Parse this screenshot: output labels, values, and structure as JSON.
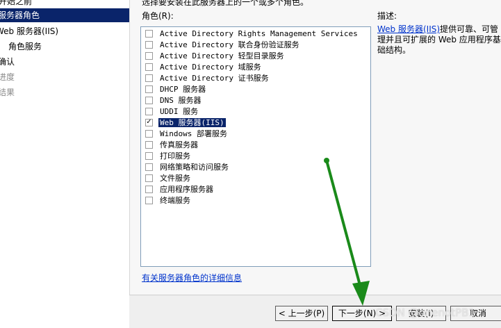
{
  "wizard": {
    "nav": [
      {
        "label": "开始之前",
        "state": "done"
      },
      {
        "label": "服务器角色",
        "state": "selected"
      },
      {
        "label": "Web 服务器(IIS)",
        "state": "normal"
      },
      {
        "label": "角色服务",
        "state": "normal"
      },
      {
        "label": "确认",
        "state": "normal"
      },
      {
        "label": "进度",
        "state": "disabled"
      },
      {
        "label": "结果",
        "state": "disabled"
      }
    ],
    "instruction": "选择要安装在此服务器上的一个或多个角色。",
    "roles_label": "角色(R):",
    "description_label": "描述:",
    "description": {
      "link_text": "Web 服务器(IIS)",
      "line1": "提供可靠、可管",
      "line2": "理并且可扩展的 Web 应用程序基",
      "line3": "础结构。"
    },
    "roles": [
      {
        "label": "Active Directory Rights Management Services",
        "checked": false,
        "selected": false
      },
      {
        "label": "Active Directory 联合身份验证服务",
        "checked": false,
        "selected": false
      },
      {
        "label": "Active Directory 轻型目录服务",
        "checked": false,
        "selected": false
      },
      {
        "label": "Active Directory 域服务",
        "checked": false,
        "selected": false
      },
      {
        "label": "Active Directory 证书服务",
        "checked": false,
        "selected": false
      },
      {
        "label": "DHCP 服务器",
        "checked": false,
        "selected": false
      },
      {
        "label": "DNS 服务器",
        "checked": false,
        "selected": false
      },
      {
        "label": "UDDI 服务",
        "checked": false,
        "selected": false
      },
      {
        "label": "Web 服务器(IIS)",
        "checked": true,
        "selected": true
      },
      {
        "label": "Windows 部署服务",
        "checked": false,
        "selected": false
      },
      {
        "label": "传真服务器",
        "checked": false,
        "selected": false
      },
      {
        "label": "打印服务",
        "checked": false,
        "selected": false
      },
      {
        "label": "网络策略和访问服务",
        "checked": false,
        "selected": false
      },
      {
        "label": "文件服务",
        "checked": false,
        "selected": false
      },
      {
        "label": "应用程序服务器",
        "checked": false,
        "selected": false
      },
      {
        "label": "终端服务",
        "checked": false,
        "selected": false
      }
    ],
    "more_info_link": "有关服务器角色的详细信息",
    "buttons": {
      "prev": "< 上一步(P)",
      "next": "下一步(N) >",
      "install": "安装(I)",
      "cancel": "取消"
    }
  },
  "overlay": {
    "arrow_color": "#1a8a1a",
    "watermark": "CSDN @onenotPB1"
  },
  "colors": {
    "selection": "#0a246a",
    "link": "#0033cc"
  }
}
